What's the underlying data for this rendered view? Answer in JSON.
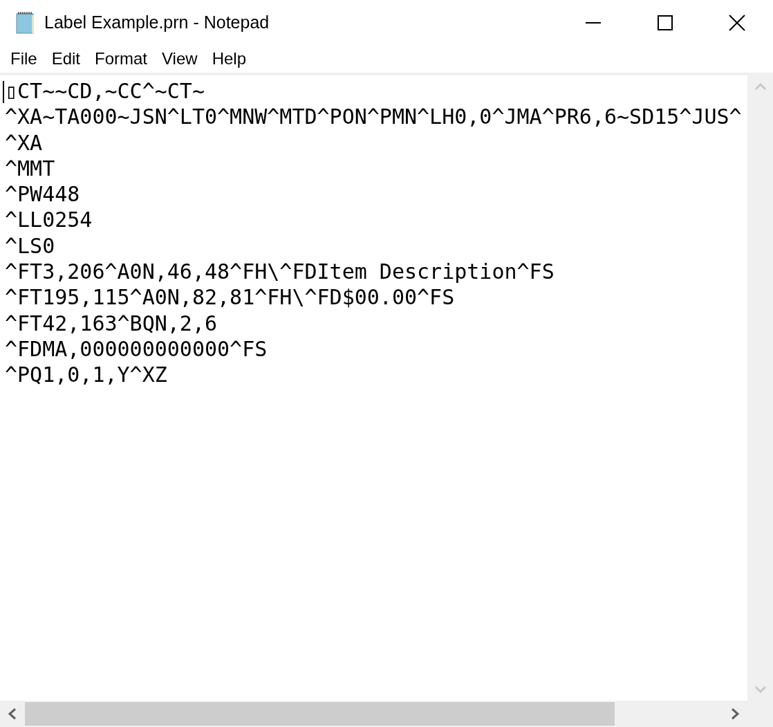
{
  "window": {
    "title": "Label Example.prn - Notepad"
  },
  "menu": [
    "File",
    "Edit",
    "Format",
    "View",
    "Help"
  ],
  "lines": [
    "▯CT~~CD,~CC^~CT~",
    "^XA~TA000~JSN^LT0^MNW^MTD^PON^PMN^LH0,0^JMA^PR6,6~SD15^JUS^",
    "^XA",
    "^MMT",
    "^PW448",
    "^LL0254",
    "^LS0",
    "^FT3,206^A0N,46,48^FH\\^FDItem Description^FS",
    "^FT195,115^A0N,82,81^FH\\^FD$00.00^FS",
    "^FT42,163^BQN,2,6",
    "^FDMA,000000000000^FS",
    "^PQ1,0,1,Y^XZ"
  ]
}
